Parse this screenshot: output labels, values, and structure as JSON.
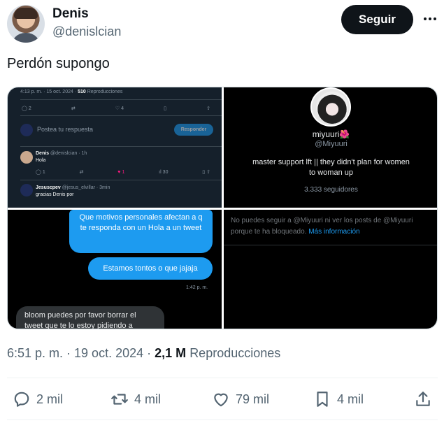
{
  "author": {
    "display_name": "Denis",
    "handle": "@denislcian",
    "follow_label": "Seguir"
  },
  "tweet": {
    "text": "Perdón supongo"
  },
  "media": {
    "screenshot1": {
      "meta_time": "4:13 p. m. · 15 oct. 2024 ·",
      "meta_views": "510",
      "meta_label": "Reproducciones",
      "actions": {
        "replies": "2",
        "retweets": "",
        "likes": "4",
        "bookmarks": ""
      },
      "reply_placeholder": "Postea tu respuesta",
      "reply_button": "Responder",
      "comment1": {
        "name": "Denis",
        "handle": "@denislcian · 1h",
        "text": "Hola",
        "replies": "1",
        "likes": "1",
        "views": "30"
      },
      "comment2": {
        "name": "Jesuscpev",
        "handle": "@jesus_elvillar · 3min",
        "text": "gracias Denis por"
      }
    },
    "screenshot2": {
      "name": "miyuuri🌺",
      "handle": "@Miyuuri",
      "bio": "master support lft || they didn't plan for women to woman up",
      "followers": "3.333 seguidores"
    },
    "screenshot3": {
      "msg1": "Que motivos personales afectan a q te responda con un Hola a un tweet",
      "msg2": "Estamos tontos o que jajaja",
      "time": "1:42 p. m.",
      "msg3": "bloom puedes por favor borrar el tweet que te lo estoy pidiendo a"
    },
    "screenshot4": {
      "blocked_text": "No puedes seguir a @Miyuuri ni ver los posts de @Miyuuri porque te ha bloqueado.",
      "link_text": "Más información"
    }
  },
  "meta": {
    "time": "6:51 p. m. · 19 oct. 2024 ·",
    "views": "2,1 M",
    "views_label": "Reproducciones"
  },
  "actions": {
    "replies": "2 mil",
    "retweets": "4 mil",
    "likes": "79 mil",
    "bookmarks": "4 mil"
  },
  "colors": {
    "accent": "#1d9bf0",
    "text": "#0f1419",
    "muted": "#536471"
  }
}
